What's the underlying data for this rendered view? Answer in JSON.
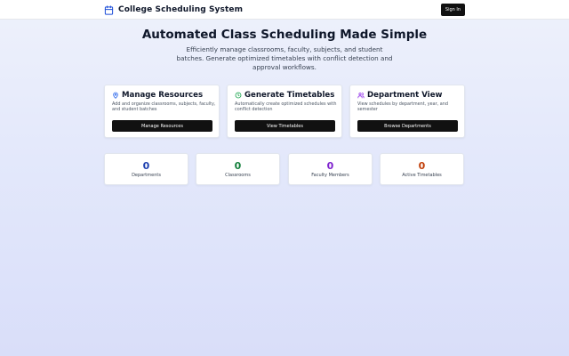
{
  "header": {
    "title": "College Scheduling System",
    "icon": "calendar-icon",
    "signin_label": "Sign In"
  },
  "hero": {
    "title": "Automated Class Scheduling Made Simple",
    "subtitle": "Efficiently manage classrooms, faculty, subjects, and student batches. Generate optimized timetables with conflict detection and approval workflows."
  },
  "cards": [
    {
      "title": "Manage Resources",
      "icon": "location-pin-icon",
      "icon_color": "#2563eb",
      "description": "Add and organize classrooms, subjects, faculty, and student batches",
      "button": "Manage Resources"
    },
    {
      "title": "Generate Timetables",
      "icon": "clock-icon",
      "icon_color": "#16a34a",
      "description": "Automatically create optimized schedules with conflict detection",
      "button": "View Timetables"
    },
    {
      "title": "Department View",
      "icon": "users-icon",
      "icon_color": "#9333ea",
      "description": "View schedules by department, year, and semester",
      "button": "Browse Departments"
    }
  ],
  "stats": [
    {
      "value": "0",
      "label": "Departments",
      "color": "#1e40af"
    },
    {
      "value": "0",
      "label": "Classrooms",
      "color": "#15803d"
    },
    {
      "value": "0",
      "label": "Faculty Members",
      "color": "#7e22ce"
    },
    {
      "value": "0",
      "label": "Active Timetables",
      "color": "#c2410c"
    }
  ],
  "colors": {
    "primary_button": "#111111",
    "background": "#e3e8fb"
  }
}
